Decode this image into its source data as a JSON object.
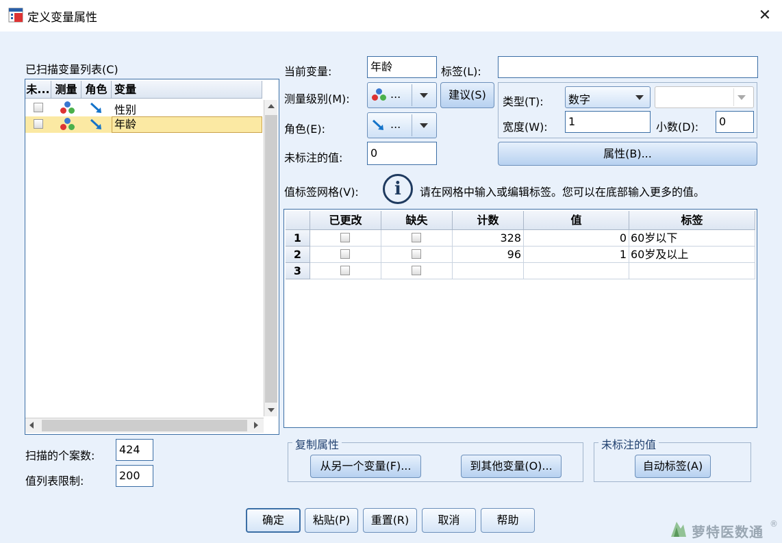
{
  "window": {
    "title": "定义变量属性",
    "close": "✕"
  },
  "scanned": {
    "title": "已扫描变量列表(C)",
    "columns": [
      "未...",
      "测量",
      "角色",
      "变量"
    ],
    "rows": [
      {
        "name": "性别",
        "selected": false
      },
      {
        "name": "年龄",
        "selected": true
      }
    ]
  },
  "case_count": {
    "label": "扫描的个案数:",
    "value": "424"
  },
  "value_limit": {
    "label": "值列表限制:",
    "value": "200"
  },
  "current_var": {
    "label": "当前变量:",
    "value": "年龄"
  },
  "label_field": {
    "label": "标签(L):",
    "value": ""
  },
  "measure": {
    "label": "测量级别(M):",
    "value": "..."
  },
  "suggest_button": "建议(S)",
  "role": {
    "label": "角色(E):",
    "value": "..."
  },
  "unlabeled": {
    "label": "未标注的值:",
    "value": "0"
  },
  "type": {
    "label": "类型(T):",
    "value": "数字"
  },
  "width": {
    "label": "宽度(W):",
    "value": "1"
  },
  "decimals": {
    "label": "小数(D):",
    "value": "0"
  },
  "attributes_button": "属性(B)...",
  "grid": {
    "label": "值标签网格(V):",
    "info": "请在网格中输入或编辑标签。您可以在底部输入更多的值。",
    "info_icon": "i",
    "columns": [
      "已更改",
      "缺失",
      "计数",
      "值",
      "标签"
    ],
    "rows": [
      {
        "num": "1",
        "count": "328",
        "value": "0",
        "label": "60岁以下"
      },
      {
        "num": "2",
        "count": "96",
        "value": "1",
        "label": "60岁及以上"
      },
      {
        "num": "3",
        "count": "",
        "value": "",
        "label": ""
      }
    ]
  },
  "copy_group": {
    "title": "复制属性",
    "from_button": "从另一个变量(F)...",
    "to_button": "到其他变量(O)..."
  },
  "unlabeled_group": {
    "title": "未标注的值",
    "auto_button": "自动标签(A)"
  },
  "footer": {
    "ok": "确定",
    "paste": "粘贴(P)",
    "reset": "重置(R)",
    "cancel": "取消",
    "help": "帮助"
  },
  "watermark": {
    "text": "萝特医数通",
    "mark": "®"
  },
  "colors": {
    "accent_border": "#3b6ea5",
    "selection": "#fbe9a3",
    "background": "#e9f1fb",
    "role_arrow": "#1473c9"
  }
}
